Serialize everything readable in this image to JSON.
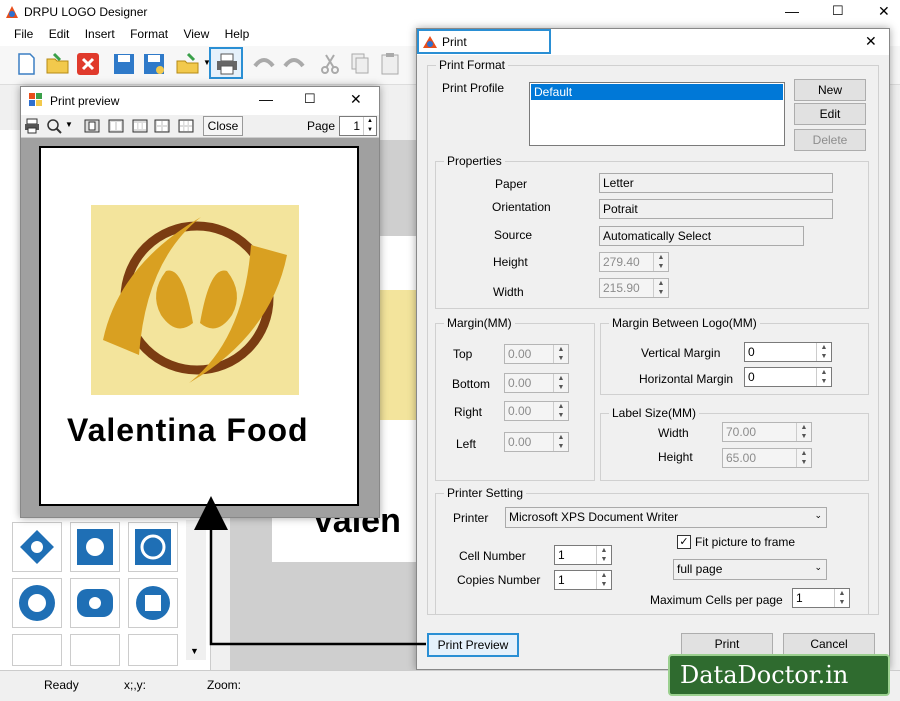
{
  "app": {
    "title": "DRPU LOGO Designer"
  },
  "menu": [
    "File",
    "Edit",
    "Insert",
    "Format",
    "View",
    "Help"
  ],
  "window_controls": {
    "minimize": "—",
    "maximize": "☐",
    "close": "✕"
  },
  "canvas_text": "Valen",
  "status": {
    "ready": "Ready",
    "coords": "x;,y:",
    "zoom": "Zoom:"
  },
  "preview": {
    "title": "Print preview",
    "close_label": "Close",
    "page_label": "Page",
    "page_value": "1",
    "logo_text": "Valentina Food",
    "colors": {
      "logo_bg": "#f3e49c",
      "ring": "#7b3c12",
      "petal": "#d9a021"
    }
  },
  "print": {
    "title": "Print",
    "print_format": {
      "title": "Print Format",
      "profile_label": "Print Profile",
      "profiles": [
        "Default"
      ],
      "new_label": "New",
      "edit_label": "Edit",
      "delete_label": "Delete"
    },
    "properties": {
      "title": "Properties",
      "paper_label": "Paper",
      "paper_value": "Letter",
      "orientation_label": "Orientation",
      "orientation_value": "Potrait",
      "source_label": "Source",
      "source_value": "Automatically Select",
      "height_label": "Height",
      "height_value": "279.40",
      "width_label": "Width",
      "width_value": "215.90"
    },
    "margin": {
      "title": "Margin(MM)",
      "top_label": "Top",
      "top_value": "0.00",
      "bottom_label": "Bottom",
      "bottom_value": "0.00",
      "right_label": "Right",
      "right_value": "0.00",
      "left_label": "Left",
      "left_value": "0.00"
    },
    "margin_between": {
      "title": "Margin Between Logo(MM)",
      "vertical_label": "Vertical Margin",
      "vertical_value": "0",
      "horizontal_label": "Horizontal Margin",
      "horizontal_value": "0"
    },
    "label_size": {
      "title": "Label Size(MM)",
      "width_label": "Width",
      "width_value": "70.00",
      "height_label": "Height",
      "height_value": "65.00"
    },
    "printer_setting": {
      "title": "Printer Setting",
      "printer_label": "Printer",
      "printer_value": "Microsoft XPS Document Writer",
      "cell_label": "Cell Number",
      "cell_value": "1",
      "copies_label": "Copies Number",
      "copies_value": "1",
      "fit_label": "Fit picture to frame",
      "fit_mode": "full page",
      "max_cells_label": "Maximum Cells per page",
      "max_cells_value": "1"
    },
    "print_preview_label": "Print Preview",
    "print_label": "Print",
    "cancel_label": "Cancel"
  },
  "watermark": "DataDoctor.in",
  "colors": {
    "highlight": "#2a8fd4",
    "selection": "#0078d7",
    "watermark_bg": "#2f6b2f"
  }
}
